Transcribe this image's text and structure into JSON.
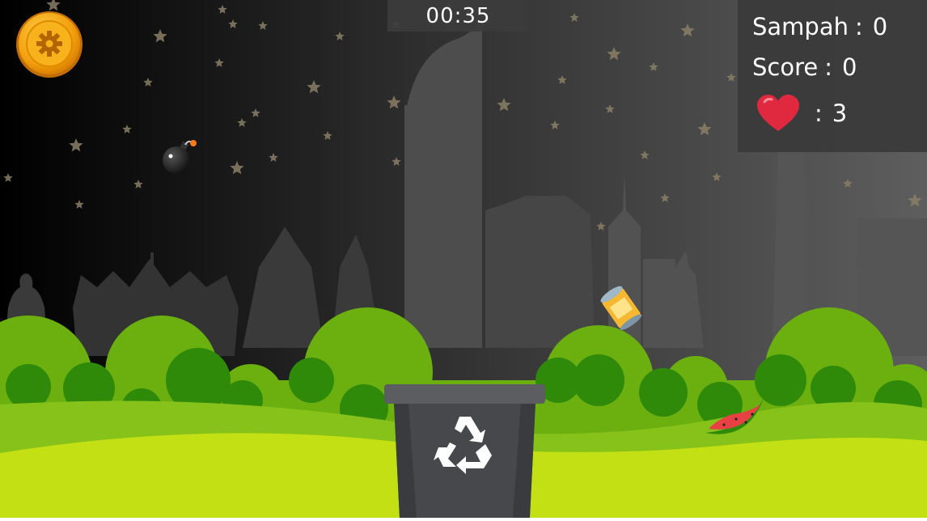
{
  "hud": {
    "timer": "00:35",
    "sampah_label": "Sampah",
    "sampah_value": "0",
    "score_label": "Score",
    "score_value": "0",
    "lives_value": "3",
    "separator": ":"
  },
  "colors": {
    "sky_dark": "#000000",
    "sky_light": "#5a5a5a",
    "grass_light": "#c2e014",
    "grass_mid": "#86c21a",
    "bush_dark": "#2f8a0a",
    "bush_light": "#6fb30f",
    "bin": "#47484b",
    "heart": "#e0293f",
    "gear_coin": "#f2a20f"
  },
  "icons": {
    "settings": "gear-icon",
    "lives": "heart-icon",
    "bin": "recycle-icon"
  },
  "objects": [
    "bomb",
    "food-can",
    "watermelon-slice"
  ]
}
